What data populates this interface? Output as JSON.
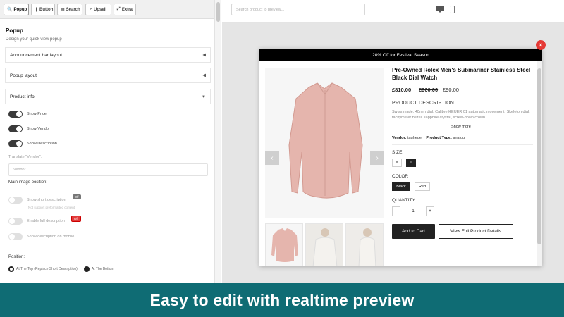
{
  "tabs": [
    {
      "label": "Popup",
      "icon": "search-icon"
    },
    {
      "label": "Button",
      "icon": "pin-icon"
    },
    {
      "label": "Search",
      "icon": "grid-icon"
    },
    {
      "label": "Upsell",
      "icon": "chart-icon"
    },
    {
      "label": "Extra",
      "icon": "expand-icon"
    }
  ],
  "section": {
    "title": "Popup",
    "subtitle": "Design your quick view popup"
  },
  "accordions": {
    "announcement": "Announcement bar layout",
    "popup_layout": "Popup layout",
    "product_info": "Product info"
  },
  "toggles": [
    {
      "label": "Show Price",
      "on": true
    },
    {
      "label": "Show Vendor",
      "on": true
    },
    {
      "label": "Show Description",
      "on": true
    }
  ],
  "translate": {
    "label": "Translate \"Vendor\":",
    "placeholder": "Vendor"
  },
  "main_image_label": "Main image position:",
  "extra_toggles": {
    "short_desc": "Show short description",
    "short_badge": "Off",
    "short_note": "Not support preformatted content",
    "full_desc": "Enable full description",
    "full_badge": "Off",
    "mobile_desc": "Show description on mobile"
  },
  "position": {
    "label": "Position:",
    "opt1": "At The Top (Replace Short Description)",
    "opt2": "At The Bottom"
  },
  "preview": {
    "search_placeholder": "Search product to preview..."
  },
  "popup": {
    "announcement": "20% Off for Festival Season",
    "title": "Pre-Owned Rolex Men's Submariner Stainless Steel Black Dial Watch",
    "price": "£810.00",
    "old_price": "£900.00",
    "save": "£90.00",
    "desc_heading": "PRODUCT DESCRIPTION",
    "desc_text": "Swiss made, 40mm dial. Calibre HEUER 01 automatic movement. Skeleton dial, tachymeter bezel, sapphire crystal, screw-down crown.",
    "show_more": "Show more",
    "vendor_label": "Vendor:",
    "vendor": "tagheuer",
    "type_label": "Product Type:",
    "type": "analog",
    "size_label": "SIZE",
    "sizes": [
      "x",
      "l"
    ],
    "color_label": "COLOR",
    "colors": [
      "Black",
      "Red"
    ],
    "qty_label": "QUANTITY",
    "qty_minus": "-",
    "qty": "1",
    "qty_plus": "+",
    "add_to_cart": "Add to Cart",
    "view_full": "View Full Product Details",
    "close": "×"
  },
  "banner": "Easy to edit with realtime preview",
  "colors": {
    "banner": "#0f6c74",
    "close": "#e53935",
    "shirt": "#e5b5ad"
  }
}
